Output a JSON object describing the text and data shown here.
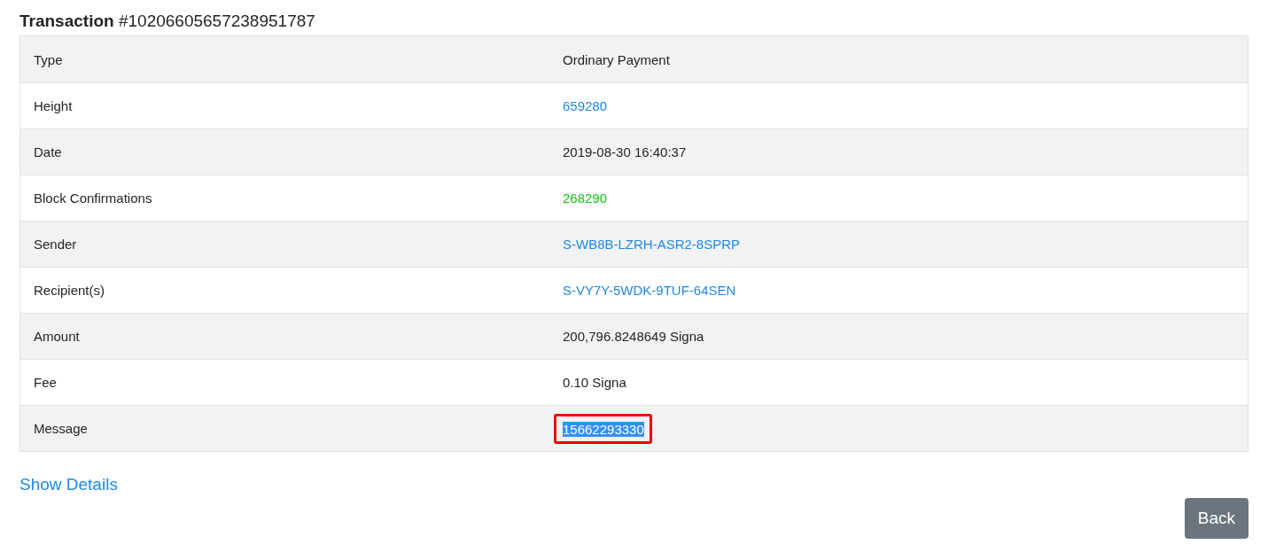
{
  "title": {
    "label": "Transaction",
    "id": "#10206605657238951787"
  },
  "rows": [
    {
      "label": "Type",
      "value": "Ordinary Payment",
      "kind": "text"
    },
    {
      "label": "Height",
      "value": "659280",
      "kind": "link"
    },
    {
      "label": "Date",
      "value": "2019-08-30 16:40:37",
      "kind": "text"
    },
    {
      "label": "Block Confirmations",
      "value": "268290",
      "kind": "success"
    },
    {
      "label": "Sender",
      "value": "S-WB8B-LZRH-ASR2-8SPRP",
      "kind": "link"
    },
    {
      "label": "Recipient(s)",
      "value": "S-VY7Y-5WDK-9TUF-64SEN",
      "kind": "link"
    },
    {
      "label": "Amount",
      "value": "200,796.8248649 Signa",
      "kind": "text"
    },
    {
      "label": "Fee",
      "value": "0.10 Signa",
      "kind": "text"
    },
    {
      "label": "Message",
      "value": "15662293330",
      "kind": "highlighted"
    }
  ],
  "show_details": "Show Details",
  "back_button": "Back"
}
